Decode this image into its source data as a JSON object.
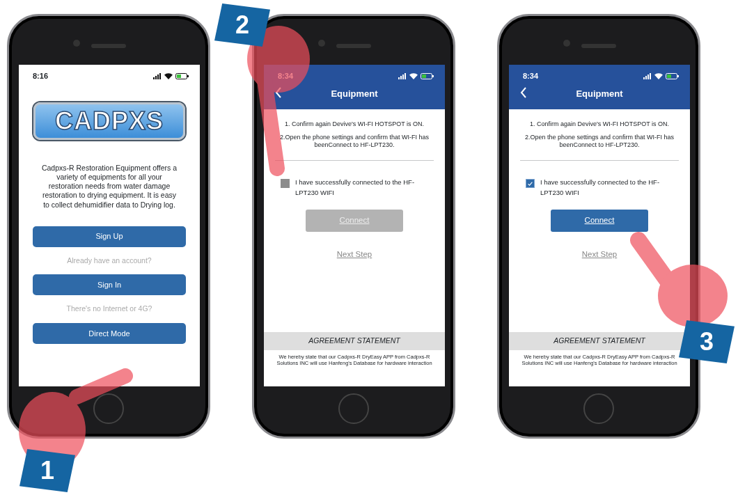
{
  "screens": [
    {
      "kind": "welcome",
      "time": "8:16",
      "logo": "CADPXS",
      "description": "Cadpxs-R Restoration Equipment offers a variety of equipments for all your restoration needs from water damage restoration to drying equipment. It is easy to collect dehumidifier data to Drying log.",
      "items": [
        {
          "kind": "button",
          "text": "Sign Up"
        },
        {
          "kind": "hint",
          "text": "Already have an account?"
        },
        {
          "kind": "button",
          "text": "Sign In"
        },
        {
          "kind": "hint",
          "text": "There's no Internet or 4G?"
        },
        {
          "kind": "button",
          "text": "Direct Mode"
        }
      ],
      "step": "1"
    },
    {
      "kind": "equipment",
      "time": "8:34",
      "title": "Equipment",
      "instructions": [
        "1. Confirm again Devive's WI-FI HOTSPOT is ON.",
        "2.Open the phone settings and confirm that WI-FI has beenConnect to HF-LPT230."
      ],
      "checkbox": {
        "label": "I have successfully connected to the HF-LPT230 WIFI",
        "checked": false
      },
      "connect": {
        "label": "Connect",
        "disabled": true
      },
      "next_step": "Next Step",
      "agreement_title": "AGREEMENT STATEMENT",
      "agreement_text": "We hereby state that our Cadpxs-R DryEasy APP from Cadpxs-R Solutions INC will use Hanfeng's Database for hardware interaction",
      "step": "2"
    },
    {
      "kind": "equipment",
      "time": "8:34",
      "title": "Equipment",
      "instructions": [
        "1. Confirm again Devive's WI-FI HOTSPOT is ON.",
        "2.Open the phone settings and confirm that WI-FI has beenConnect to HF-LPT230."
      ],
      "checkbox": {
        "label": "I have successfully connected to the HF-LPT230 WIFI",
        "checked": true
      },
      "connect": {
        "label": "Connect",
        "disabled": false
      },
      "next_step": "Next Step",
      "agreement_title": "AGREEMENT STATEMENT",
      "agreement_text": "We hereby state that our Cadpxs-R DryEasy APP from Cadpxs-R Solutions INC will use Hanfeng's Database for hardware interaction",
      "step": "3"
    }
  ]
}
